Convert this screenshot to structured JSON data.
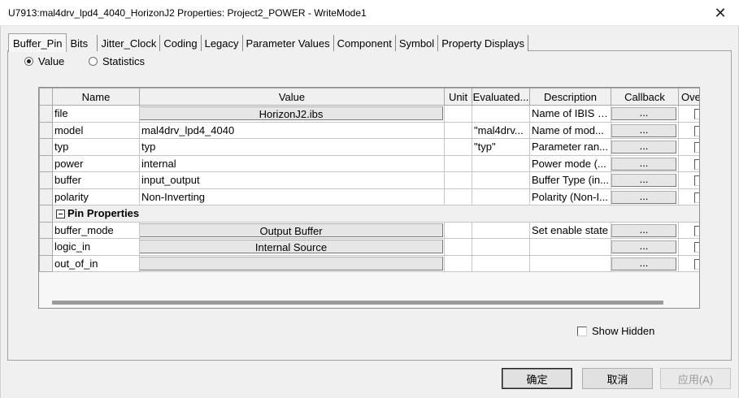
{
  "window": {
    "title": "U7913:mal4drv_lpd4_4040_HorizonJ2 Properties: Project2_POWER - WriteMode1",
    "close_glyph": "✕"
  },
  "tabs": [
    "Buffer_Pin",
    "Bits",
    "Jitter_Clock",
    "Coding",
    "Legacy",
    "Parameter Values",
    "Component",
    "Symbol",
    "Property Displays"
  ],
  "active_tab": "Buffer_Pin",
  "mode": {
    "options": [
      "Value",
      "Statistics"
    ],
    "selected": "Value"
  },
  "grid": {
    "columns": [
      "Name",
      "Value",
      "Unit",
      "Evaluated...",
      "Description",
      "Callback",
      "Over"
    ],
    "rows": [
      {
        "name": "file",
        "value": "HorizonJ2.ibs",
        "value_button": true,
        "unit": "",
        "evaluated": "",
        "description": "Name of IBIS fi...",
        "callback": "...",
        "override": false
      },
      {
        "name": "model",
        "value": "mal4drv_lpd4_4040",
        "value_button": false,
        "unit": "",
        "evaluated": "\"mal4drv...",
        "description": "Name of mod...",
        "callback": "...",
        "override": false
      },
      {
        "name": "typ",
        "value": "typ",
        "value_button": false,
        "unit": "",
        "evaluated": "\"typ\"",
        "description": "Parameter ran...",
        "callback": "...",
        "override": false
      },
      {
        "name": "power",
        "value": "internal",
        "value_button": false,
        "unit": "",
        "evaluated": "",
        "description": "Power mode (...",
        "callback": "...",
        "override": false
      },
      {
        "name": "buffer",
        "value": "input_output",
        "value_button": false,
        "unit": "",
        "evaluated": "",
        "description": "Buffer Type (in...",
        "callback": "...",
        "override": false
      },
      {
        "name": "polarity",
        "value": "Non-Inverting",
        "value_button": false,
        "unit": "",
        "evaluated": "",
        "description": "Polarity (Non-I...",
        "callback": "...",
        "override": false
      }
    ],
    "category": {
      "label": "Pin Properties"
    },
    "pin_rows": [
      {
        "name": "buffer_mode",
        "value": "Output Buffer",
        "value_button": true,
        "unit": "",
        "evaluated": "",
        "description": "Set enable state",
        "callback": "...",
        "override": false
      },
      {
        "name": "logic_in",
        "value": "Internal Source",
        "value_button": true,
        "unit": "",
        "evaluated": "",
        "description": "",
        "callback": "...",
        "override": false
      },
      {
        "name": "out_of_in",
        "value": "",
        "value_button": true,
        "unit": "",
        "evaluated": "",
        "description": "",
        "callback": "...",
        "override": false
      }
    ]
  },
  "show_hidden": {
    "label": "Show Hidden",
    "checked": false
  },
  "buttons": {
    "ok": "确定",
    "cancel": "取消",
    "apply": "应用(A)"
  }
}
